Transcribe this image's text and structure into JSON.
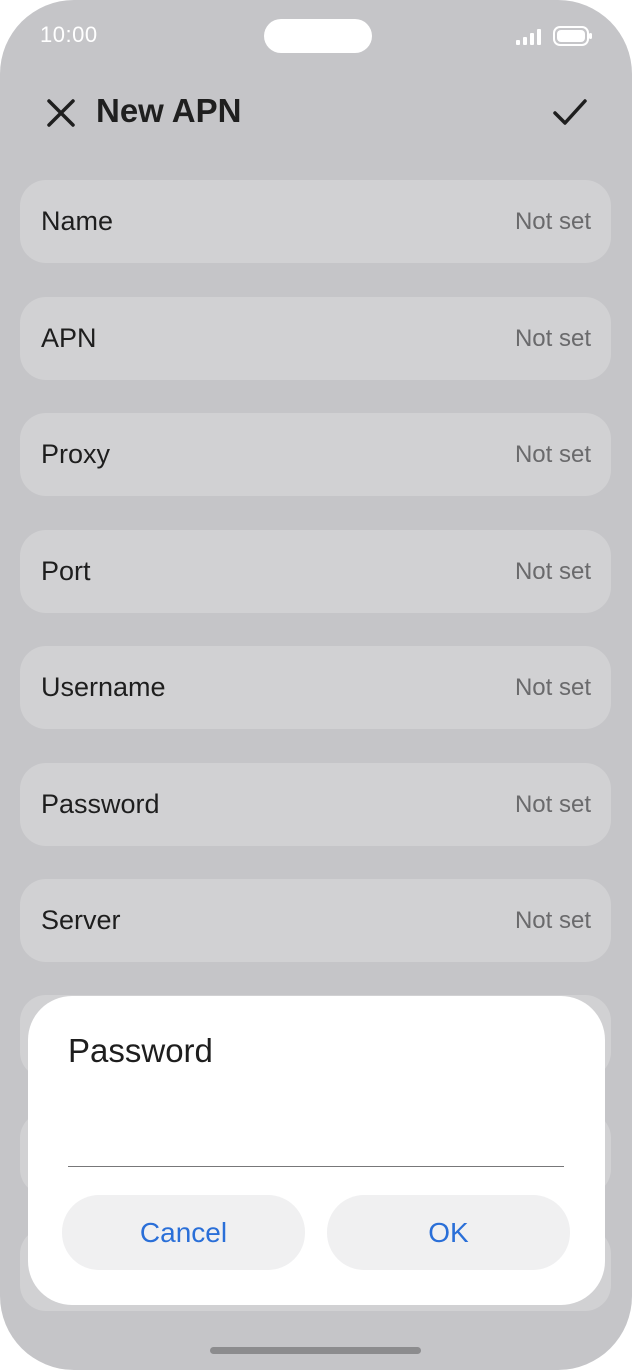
{
  "status_bar": {
    "time": "10:00",
    "icons": [
      "signal-icon",
      "battery-icon"
    ]
  },
  "app_bar": {
    "title": "New APN",
    "close_icon": "close-icon",
    "confirm_icon": "check-icon"
  },
  "fields": [
    {
      "label": "Name",
      "value": "Not set"
    },
    {
      "label": "APN",
      "value": "Not set"
    },
    {
      "label": "Proxy",
      "value": "Not set"
    },
    {
      "label": "Port",
      "value": "Not set"
    },
    {
      "label": "Username",
      "value": "Not set"
    },
    {
      "label": "Password",
      "value": "Not set"
    },
    {
      "label": "Server",
      "value": "Not set"
    }
  ],
  "dialog": {
    "title": "Password",
    "input_value": "",
    "cancel_label": "Cancel",
    "ok_label": "OK"
  },
  "colors": {
    "scrim_background": "#c5c5c8",
    "row_background": "#d1d1d3",
    "dialog_background": "#ffffff",
    "button_text": "#2a6fd8",
    "button_background": "#f0f0f1"
  }
}
